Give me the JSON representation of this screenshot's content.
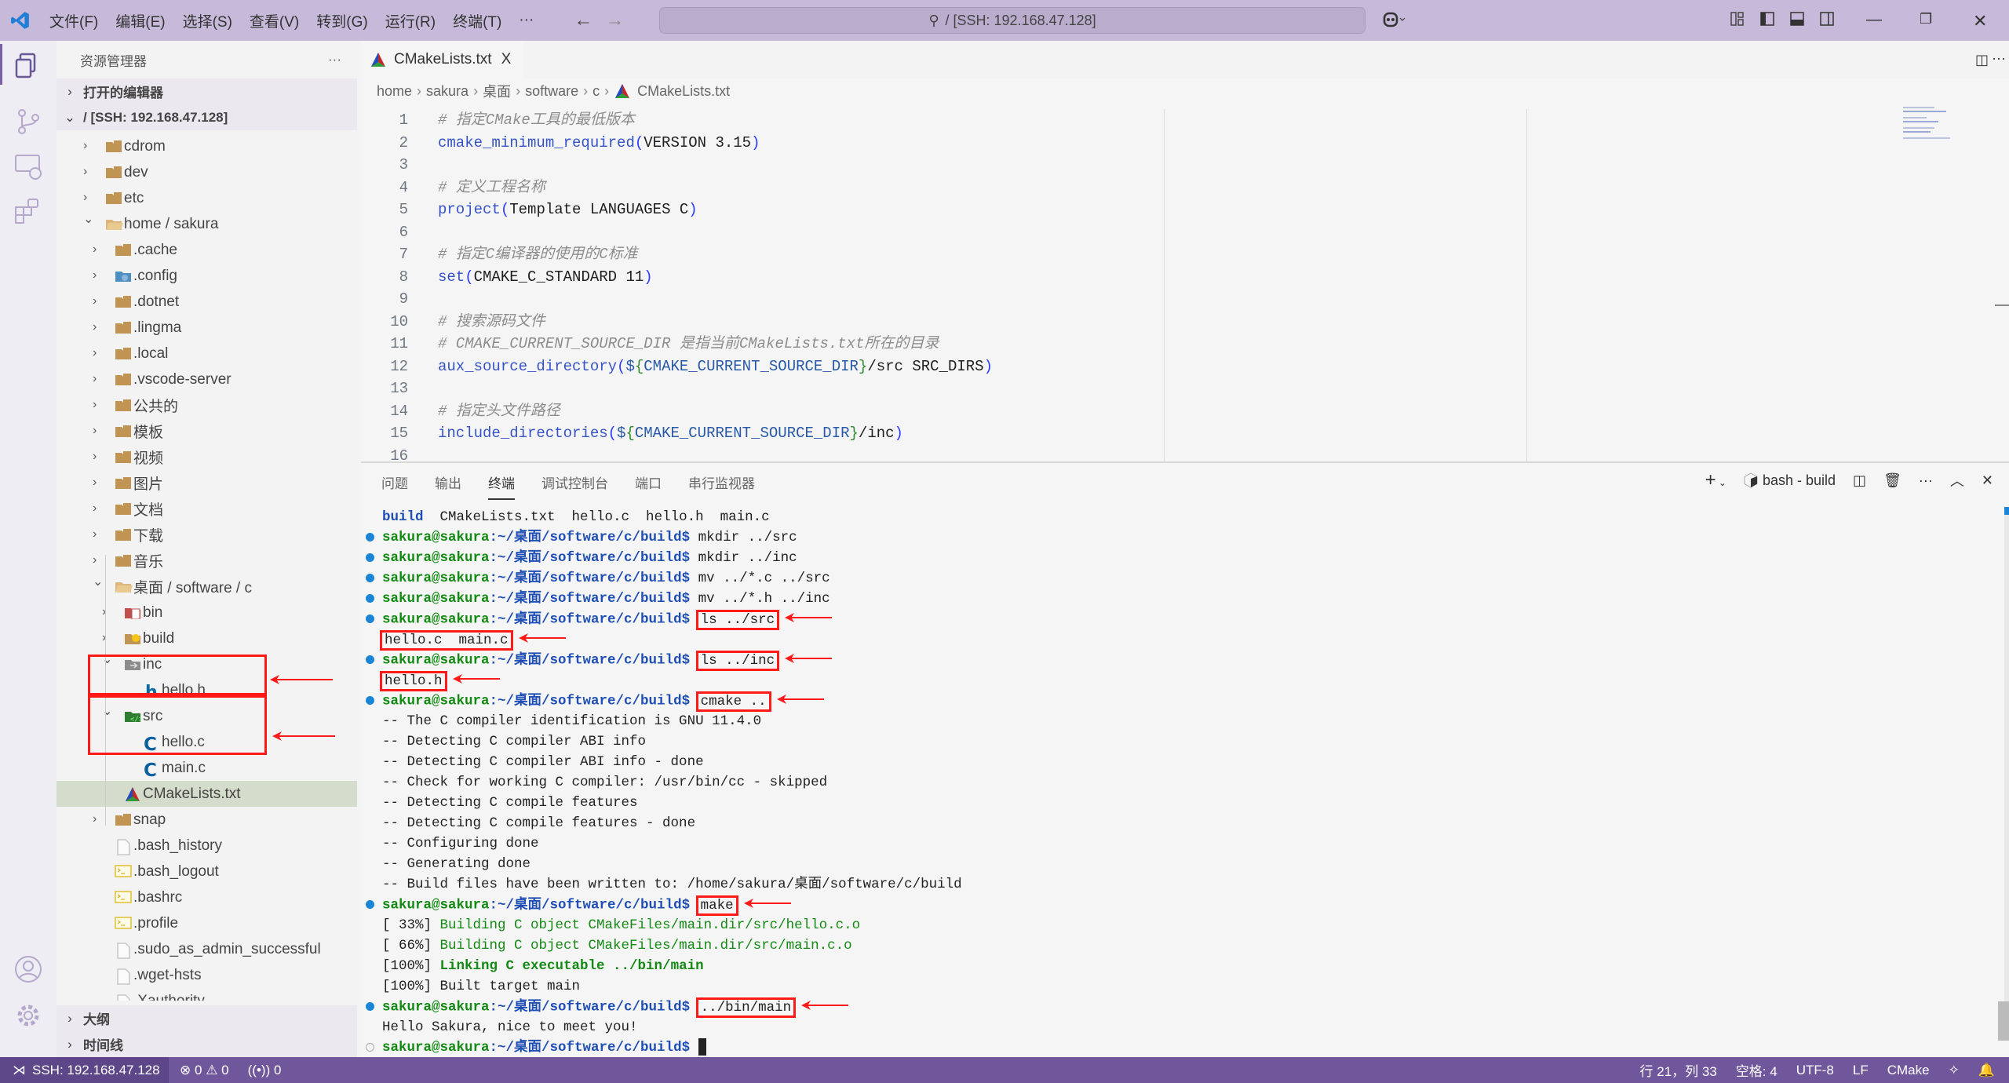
{
  "titlebar": {
    "menus": [
      "文件(F)",
      "编辑(E)",
      "选择(S)",
      "查看(V)",
      "转到(G)",
      "运行(R)",
      "终端(T)",
      "···"
    ],
    "search": "/ [SSH: 192.168.47.128]"
  },
  "sidebar": {
    "title": "资源管理器",
    "more": "···",
    "open_editors": "打开的编辑器",
    "root": "/ [SSH: 192.168.47.128]",
    "tree": [
      {
        "label": "cdrom",
        "depth": 0,
        "chev": "right",
        "icon": "folder"
      },
      {
        "label": "dev",
        "depth": 0,
        "chev": "right",
        "icon": "folder"
      },
      {
        "label": "etc",
        "depth": 0,
        "chev": "right",
        "icon": "folder"
      },
      {
        "label": "home / sakura",
        "depth": 0,
        "chev": "down",
        "icon": "folder-open"
      },
      {
        "label": ".cache",
        "depth": 1,
        "chev": "right",
        "icon": "folder"
      },
      {
        "label": ".config",
        "depth": 1,
        "chev": "right",
        "icon": "folder-config"
      },
      {
        "label": ".dotnet",
        "depth": 1,
        "chev": "right",
        "icon": "folder"
      },
      {
        "label": ".lingma",
        "depth": 1,
        "chev": "right",
        "icon": "folder"
      },
      {
        "label": ".local",
        "depth": 1,
        "chev": "right",
        "icon": "folder"
      },
      {
        "label": ".vscode-server",
        "depth": 1,
        "chev": "right",
        "icon": "folder"
      },
      {
        "label": "公共的",
        "depth": 1,
        "chev": "right",
        "icon": "folder"
      },
      {
        "label": "模板",
        "depth": 1,
        "chev": "right",
        "icon": "folder"
      },
      {
        "label": "视频",
        "depth": 1,
        "chev": "right",
        "icon": "folder"
      },
      {
        "label": "图片",
        "depth": 1,
        "chev": "right",
        "icon": "folder"
      },
      {
        "label": "文档",
        "depth": 1,
        "chev": "right",
        "icon": "folder"
      },
      {
        "label": "下载",
        "depth": 1,
        "chev": "right",
        "icon": "folder"
      },
      {
        "label": "音乐",
        "depth": 1,
        "chev": "right",
        "icon": "folder"
      },
      {
        "label": "桌面 / software / c",
        "depth": 1,
        "chev": "down",
        "icon": "folder-open"
      },
      {
        "label": "bin",
        "depth": 2,
        "chev": "right",
        "icon": "folder-bin"
      },
      {
        "label": "build",
        "depth": 2,
        "chev": "right",
        "icon": "folder-build"
      },
      {
        "label": "inc",
        "depth": 2,
        "chev": "down",
        "icon": "folder-inc"
      },
      {
        "label": "hello.h",
        "depth": 3,
        "chev": "",
        "icon": "h-file"
      },
      {
        "label": "src",
        "depth": 2,
        "chev": "down",
        "icon": "folder-src"
      },
      {
        "label": "hello.c",
        "depth": 3,
        "chev": "",
        "icon": "c-file"
      },
      {
        "label": "main.c",
        "depth": 3,
        "chev": "",
        "icon": "c-file"
      },
      {
        "label": "CMakeLists.txt",
        "depth": 2,
        "chev": "",
        "icon": "cmake",
        "selected": true
      },
      {
        "label": "snap",
        "depth": 1,
        "chev": "right",
        "icon": "folder"
      },
      {
        "label": ".bash_history",
        "depth": 1,
        "chev": "",
        "icon": "file"
      },
      {
        "label": ".bash_logout",
        "depth": 1,
        "chev": "",
        "icon": "shell"
      },
      {
        "label": ".bashrc",
        "depth": 1,
        "chev": "",
        "icon": "shell"
      },
      {
        "label": ".profile",
        "depth": 1,
        "chev": "",
        "icon": "shell"
      },
      {
        "label": ".sudo_as_admin_successful",
        "depth": 1,
        "chev": "",
        "icon": "file"
      },
      {
        "label": ".wget-hsts",
        "depth": 1,
        "chev": "",
        "icon": "file"
      },
      {
        "label": ".Xauthority",
        "depth": 1,
        "chev": "",
        "icon": "file"
      }
    ],
    "outline": "大纲",
    "timeline": "时间线"
  },
  "editor": {
    "tab": "CMakeLists.txt",
    "tab_close": "X",
    "breadcrumb": [
      "home",
      "sakura",
      "桌面",
      "software",
      "c",
      "CMakeLists.txt"
    ],
    "lines": [
      [
        {
          "t": "# 指定CMake工具的最低版本",
          "c": "com"
        }
      ],
      [
        {
          "t": "cmake_minimum_required",
          "c": "fn"
        },
        {
          "t": "(",
          "c": "par"
        },
        {
          "t": "VERSION 3.15",
          "c": "txt"
        },
        {
          "t": ")",
          "c": "par"
        }
      ],
      [],
      [
        {
          "t": "# 定义工程名称",
          "c": "com"
        }
      ],
      [
        {
          "t": "project",
          "c": "fn"
        },
        {
          "t": "(",
          "c": "par"
        },
        {
          "t": "Template LANGUAGES C",
          "c": "txt"
        },
        {
          "t": ")",
          "c": "par"
        }
      ],
      [],
      [
        {
          "t": "# 指定C编译器的使用的C标准",
          "c": "com"
        }
      ],
      [
        {
          "t": "set",
          "c": "fn"
        },
        {
          "t": "(",
          "c": "par"
        },
        {
          "t": "CMAKE_C_STANDARD 11",
          "c": "txt"
        },
        {
          "t": ")",
          "c": "par"
        }
      ],
      [],
      [
        {
          "t": "# 搜索源码文件",
          "c": "com"
        }
      ],
      [
        {
          "t": "# CMAKE_CURRENT_SOURCE_DIR 是指当前CMakeLists.txt所在的目录",
          "c": "com"
        }
      ],
      [
        {
          "t": "aux_source_directory",
          "c": "fn"
        },
        {
          "t": "(",
          "c": "par"
        },
        {
          "t": "$",
          "c": "var"
        },
        {
          "t": "{",
          "c": "br"
        },
        {
          "t": "CMAKE_CURRENT_SOURCE_DIR",
          "c": "var"
        },
        {
          "t": "}",
          "c": "br"
        },
        {
          "t": "/src SRC_DIRS",
          "c": "txt"
        },
        {
          "t": ")",
          "c": "par"
        }
      ],
      [],
      [
        {
          "t": "# 指定头文件路径",
          "c": "com"
        }
      ],
      [
        {
          "t": "include_directories",
          "c": "fn"
        },
        {
          "t": "(",
          "c": "par"
        },
        {
          "t": "$",
          "c": "var"
        },
        {
          "t": "{",
          "c": "br"
        },
        {
          "t": "CMAKE_CURRENT_SOURCE_DIR",
          "c": "var"
        },
        {
          "t": "}",
          "c": "br"
        },
        {
          "t": "/inc",
          "c": "txt"
        },
        {
          "t": ")",
          "c": "par"
        }
      ],
      []
    ]
  },
  "panel": {
    "tabs": [
      "问题",
      "输出",
      "终端",
      "调试控制台",
      "端口",
      "串行监视器"
    ],
    "active_tab": 2,
    "terminal_name": "bash - build",
    "prompt_user": "sakura@sakura",
    "prompt_path": ":~/桌面/software/c/build$",
    "lines": [
      {
        "mark": "",
        "segs": [
          {
            "t": "build",
            "s": "dir"
          },
          {
            "t": "  CMakeLists.txt  hello.c  hello.h  main.c",
            "s": ""
          }
        ]
      },
      {
        "mark": "dot",
        "prompt": true,
        "segs": [
          {
            "t": " mkdir ../src",
            "s": ""
          }
        ]
      },
      {
        "mark": "dot",
        "prompt": true,
        "segs": [
          {
            "t": " mkdir ../inc",
            "s": ""
          }
        ]
      },
      {
        "mark": "dot",
        "prompt": true,
        "segs": [
          {
            "t": " mv ../*.c ../src",
            "s": ""
          }
        ]
      },
      {
        "mark": "dot",
        "prompt": true,
        "segs": [
          {
            "t": " mv ../*.h ../inc",
            "s": ""
          }
        ]
      },
      {
        "mark": "dot",
        "prompt": true,
        "segs": [
          {
            "t": " ",
            "s": ""
          },
          {
            "t": "ls ../src",
            "s": "hl"
          }
        ],
        "arrow": true
      },
      {
        "mark": "",
        "segs": [
          {
            "t": "hello.c  main.c",
            "s": "hl"
          }
        ],
        "arrow": true
      },
      {
        "mark": "dot",
        "prompt": true,
        "segs": [
          {
            "t": " ",
            "s": ""
          },
          {
            "t": "ls ../inc",
            "s": "hl"
          }
        ],
        "arrow": true
      },
      {
        "mark": "",
        "segs": [
          {
            "t": "hello.h",
            "s": "hl"
          }
        ],
        "arrow": true
      },
      {
        "mark": "dot",
        "prompt": true,
        "segs": [
          {
            "t": " ",
            "s": ""
          },
          {
            "t": "cmake ..",
            "s": "hl"
          }
        ],
        "arrow": true
      },
      {
        "mark": "",
        "segs": [
          {
            "t": "-- The C compiler identification is GNU 11.4.0",
            "s": ""
          }
        ]
      },
      {
        "mark": "",
        "segs": [
          {
            "t": "-- Detecting C compiler ABI info",
            "s": ""
          }
        ]
      },
      {
        "mark": "",
        "segs": [
          {
            "t": "-- Detecting C compiler ABI info - done",
            "s": ""
          }
        ]
      },
      {
        "mark": "",
        "segs": [
          {
            "t": "-- Check for working C compiler: /usr/bin/cc - skipped",
            "s": ""
          }
        ]
      },
      {
        "mark": "",
        "segs": [
          {
            "t": "-- Detecting C compile features",
            "s": ""
          }
        ]
      },
      {
        "mark": "",
        "segs": [
          {
            "t": "-- Detecting C compile features - done",
            "s": ""
          }
        ]
      },
      {
        "mark": "",
        "segs": [
          {
            "t": "-- Configuring done",
            "s": ""
          }
        ]
      },
      {
        "mark": "",
        "segs": [
          {
            "t": "-- Generating done",
            "s": ""
          }
        ]
      },
      {
        "mark": "",
        "segs": [
          {
            "t": "-- Build files have been written to: /home/sakura/桌面/software/c/build",
            "s": ""
          }
        ]
      },
      {
        "mark": "dot",
        "prompt": true,
        "segs": [
          {
            "t": " ",
            "s": ""
          },
          {
            "t": "make",
            "s": "hl"
          }
        ],
        "arrow": true
      },
      {
        "mark": "",
        "segs": [
          {
            "t": "[ 33%] ",
            "s": ""
          },
          {
            "t": "Building C object CMakeFiles/main.dir/src/hello.c.o",
            "s": "grn"
          }
        ]
      },
      {
        "mark": "",
        "segs": [
          {
            "t": "[ 66%] ",
            "s": ""
          },
          {
            "t": "Building C object CMakeFiles/main.dir/src/main.c.o",
            "s": "grn"
          }
        ]
      },
      {
        "mark": "",
        "segs": [
          {
            "t": "[100%] ",
            "s": ""
          },
          {
            "t": "Linking C executable ../bin/main",
            "s": "grnb"
          }
        ]
      },
      {
        "mark": "",
        "segs": [
          {
            "t": "[100%] Built target main",
            "s": ""
          }
        ]
      },
      {
        "mark": "dot",
        "prompt": true,
        "segs": [
          {
            "t": " ",
            "s": ""
          },
          {
            "t": "../bin/main",
            "s": "hl"
          }
        ],
        "arrow": true
      },
      {
        "mark": "",
        "segs": [
          {
            "t": "Hello Sakura, nice to meet you!",
            "s": ""
          }
        ]
      },
      {
        "mark": "ring",
        "prompt": true,
        "segs": [
          {
            "t": " ",
            "s": ""
          }
        ],
        "cursor": true
      }
    ]
  },
  "statusbar": {
    "remote": "SSH: 192.168.47.128",
    "errors": "0",
    "warnings": "0",
    "ports": "0",
    "position": "行 21，列 33",
    "indent": "空格: 4",
    "encoding": "UTF-8",
    "eol": "LF",
    "language": "CMake"
  },
  "colors": {
    "titlebar": "#c6b9d9",
    "statusbar": "#70569a",
    "highlight": "#ff1a1a",
    "prompt_green": "#138a13",
    "prompt_blue": "#1f4fb5"
  }
}
